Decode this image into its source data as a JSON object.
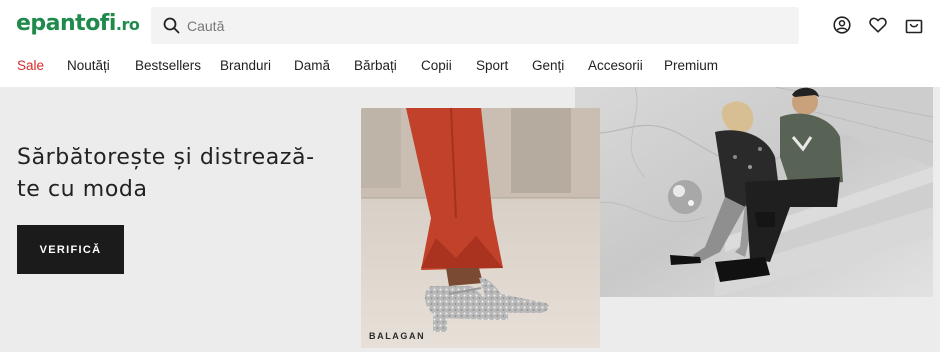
{
  "header": {
    "logo_main": "epantofi",
    "logo_tld": ".ro",
    "search_placeholder": "Caută",
    "icons": [
      "account-icon",
      "heart-icon",
      "cart-icon"
    ]
  },
  "nav": {
    "items": [
      "Sale",
      "Noutăți",
      "Bestsellers",
      "Branduri",
      "Damă",
      "Bărbați",
      "Copii",
      "Sport",
      "Genți",
      "Accesorii",
      "Premium"
    ]
  },
  "hero": {
    "headline_line1": "Sărbătorește și distrează-",
    "headline_line2": "te cu moda",
    "cta_label": "VERIFICĂ",
    "image_left_brand": "BALAGAN"
  },
  "colors": {
    "brand_green": "#1f8a4c",
    "sale_red": "#d62b2b",
    "cta_bg": "#1b1b1b",
    "hero_bg": "#ececec"
  }
}
